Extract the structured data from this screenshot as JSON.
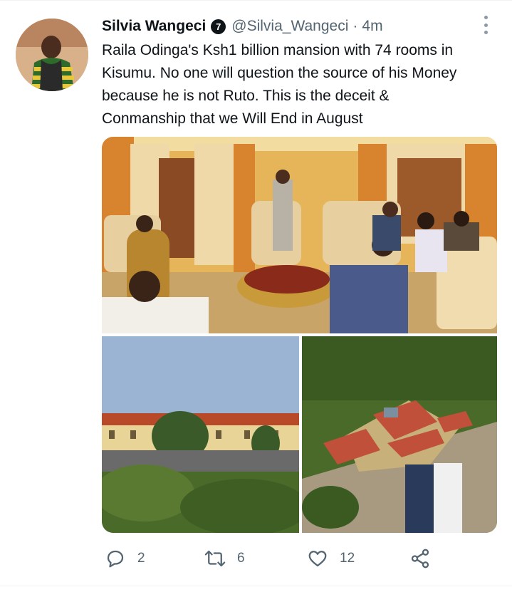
{
  "tweet": {
    "author_name": "Silvia Wangeci",
    "badge_number": "7",
    "handle": "@Silvia_Wangeci",
    "separator": "·",
    "time": "4m",
    "text_lines": [
      "Raila Odinga's Ksh1 billion mansion with 74 rooms in",
      "Kisumu. No one will question the source of his Money",
      "because he is not Ruto. This is the deceit &",
      "Conmanship that we Will End in August"
    ],
    "media": [
      {
        "subject": "living-room-meeting-photo"
      },
      {
        "subject": "mansion-exterior-photo"
      },
      {
        "subject": "mansion-aerial-photo"
      }
    ],
    "stats": {
      "replies": "2",
      "retweets": "6",
      "likes": "12"
    }
  },
  "icons": {
    "reply": "reply-icon",
    "retweet": "retweet-icon",
    "like": "heart-icon",
    "share": "share-icon",
    "more": "more-options-icon"
  },
  "colors": {
    "text_primary": "#0f1419",
    "text_secondary": "#536471",
    "divider": "#eff3f4"
  }
}
